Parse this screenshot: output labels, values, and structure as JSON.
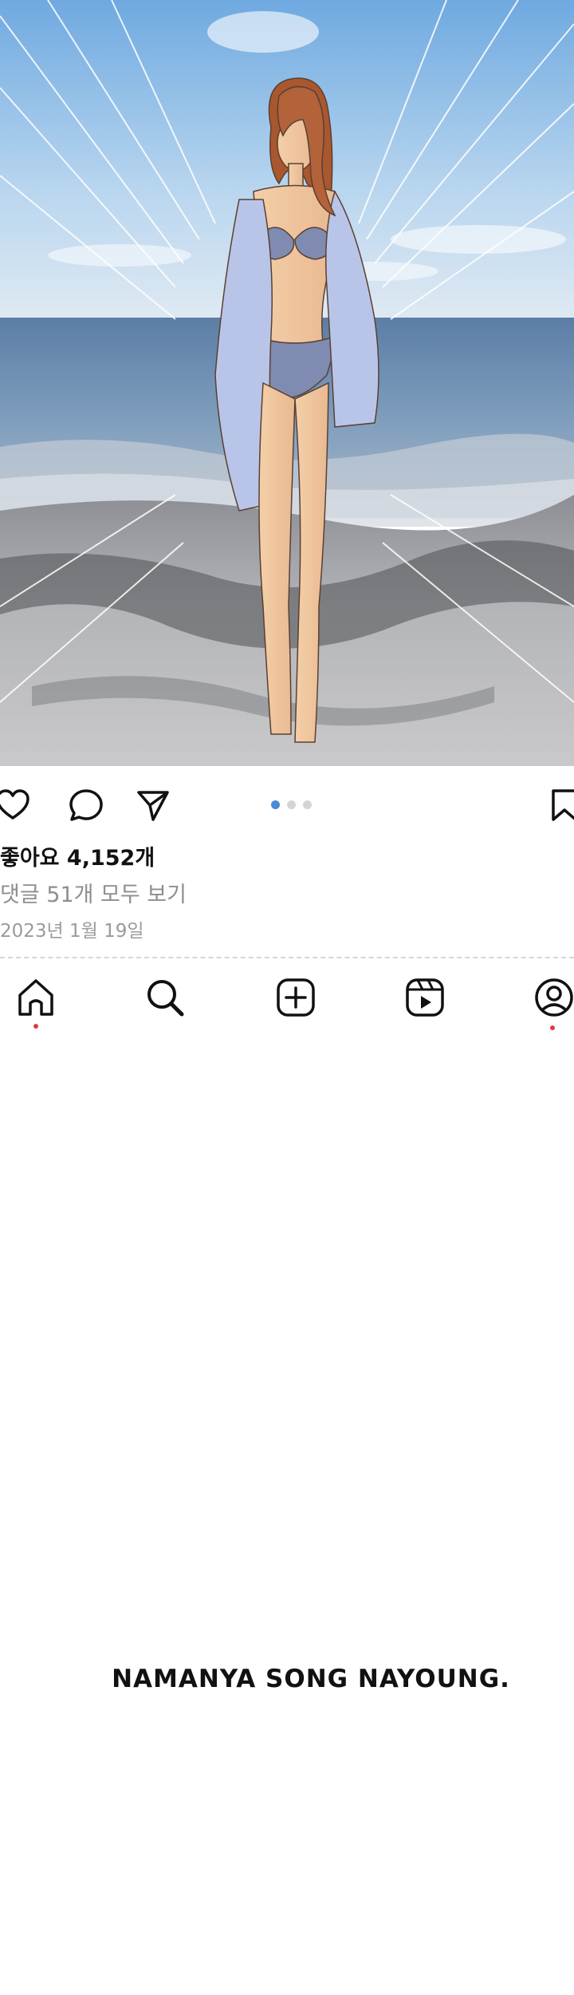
{
  "post": {
    "image_alt": "Illustration of a woman in a blue bikini holding a light blue shirt, standing on a beach with the sea behind her",
    "carousel": {
      "count": 3,
      "active_index": 0
    },
    "actions": {
      "like_icon": "heart-icon",
      "comment_icon": "comment-bubble-icon",
      "share_icon": "paper-plane-icon",
      "save_icon": "bookmark-icon"
    },
    "likes_text": "좋아요 4,152개",
    "comments_text": "댓글 51개 모두 보기",
    "date_text": "2023년 1월 19일"
  },
  "bottom_nav": {
    "items": [
      {
        "icon": "home-icon",
        "has_dot": true
      },
      {
        "icon": "search-icon",
        "has_dot": false
      },
      {
        "icon": "add-post-icon",
        "has_dot": false
      },
      {
        "icon": "reels-icon",
        "has_dot": false
      },
      {
        "icon": "profile-icon",
        "has_dot": true
      }
    ]
  },
  "narration": {
    "text": "NAMANYA SONG NAYOUNG."
  },
  "colors": {
    "sky_top": "#7fb6e6",
    "sea": "#6f8fb3",
    "sand": "#b9b9bb",
    "carousel_active": "#4a8ad6",
    "notification_dot": "#e23b3b"
  }
}
